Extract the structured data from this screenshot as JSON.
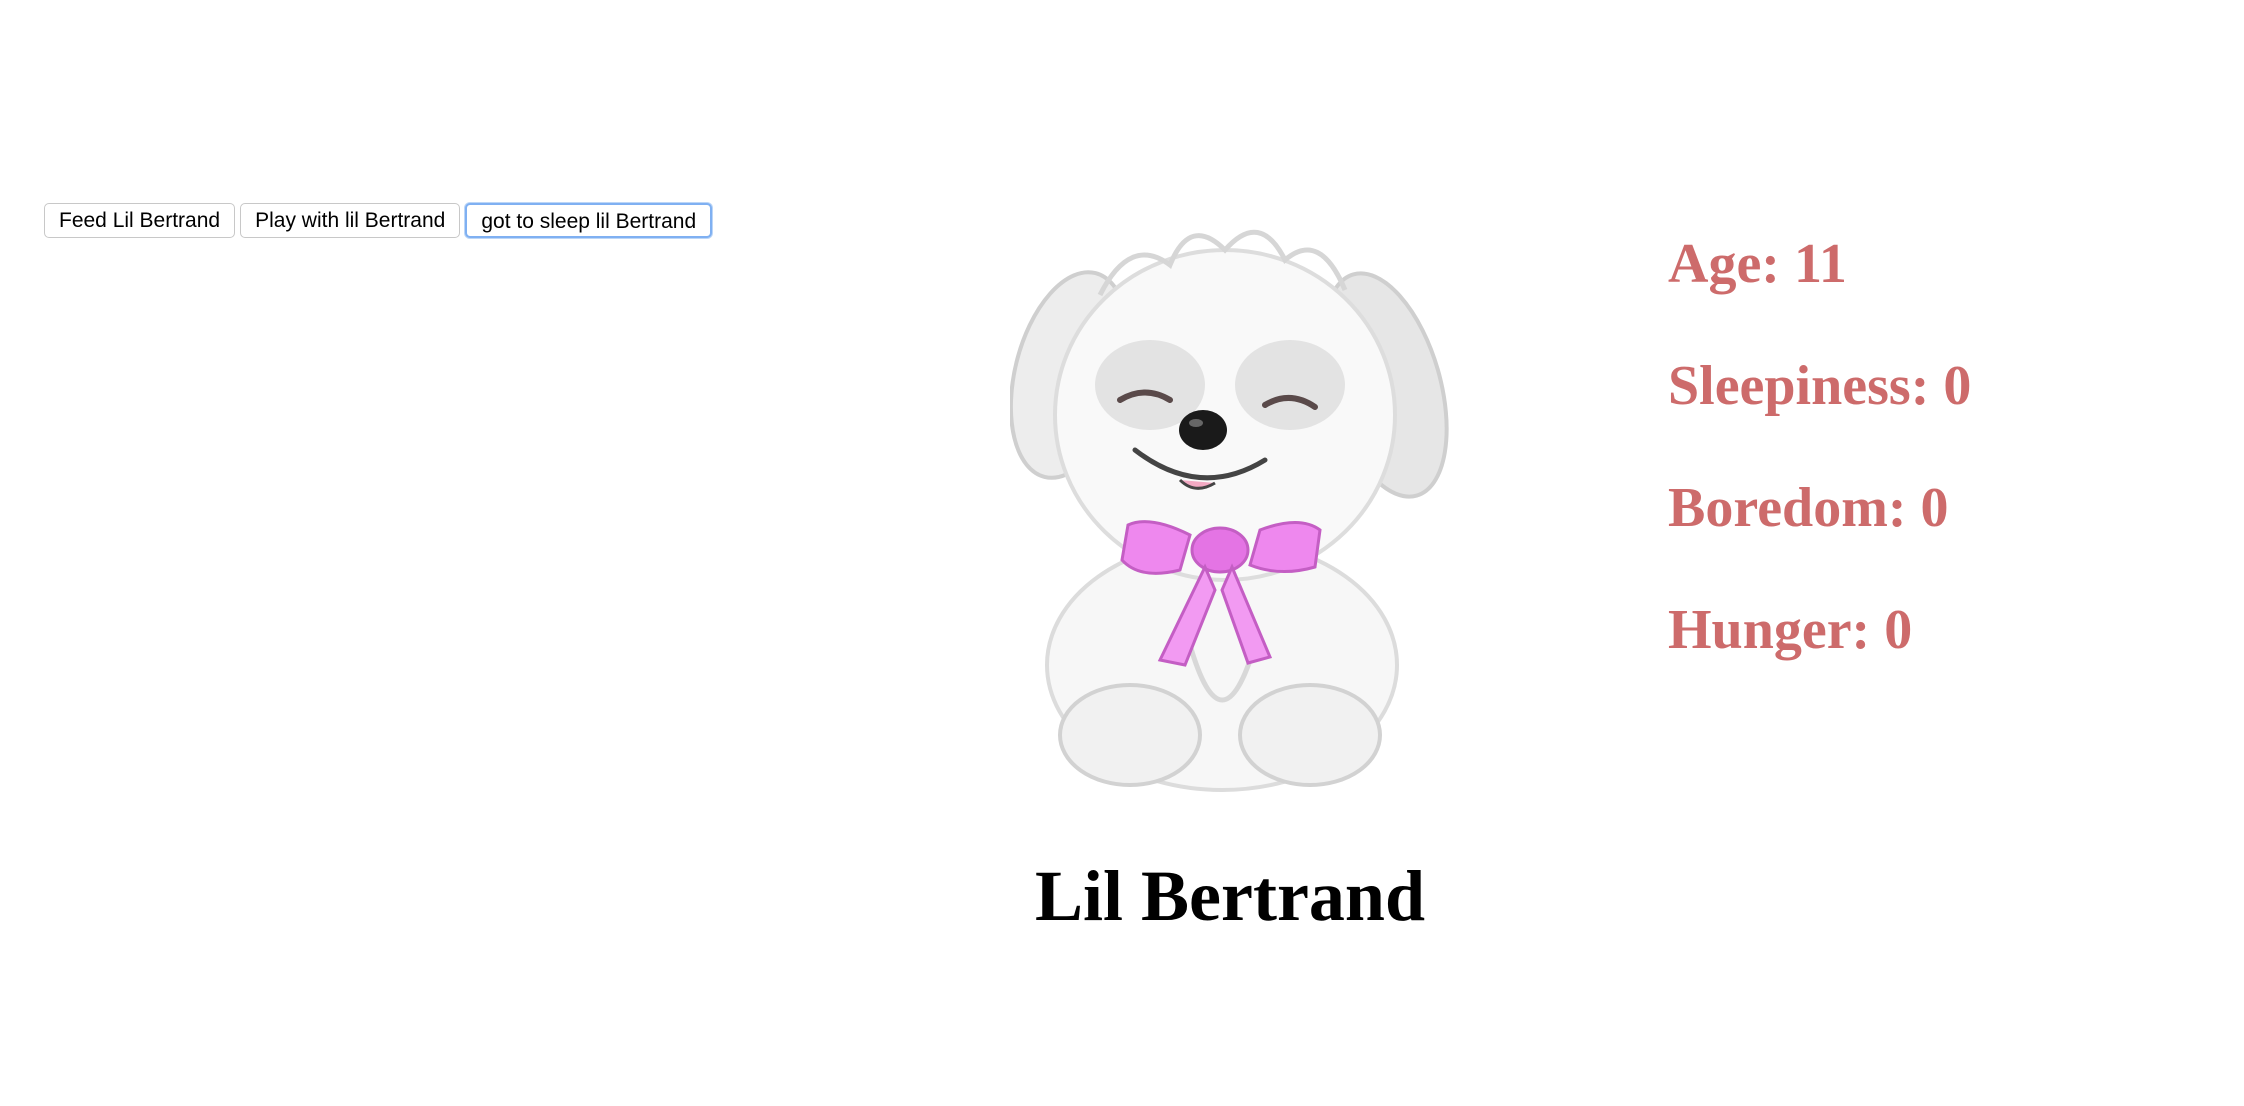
{
  "buttons": {
    "feed_label": "Feed Lil Bertrand",
    "play_label": "Play with lil Bertrand",
    "sleep_label": "got to sleep lil Bertrand"
  },
  "pet": {
    "name": "Lil Bertrand",
    "image_icon": "puppy-with-pink-bow"
  },
  "stats": {
    "age": "Age: 11",
    "sleepiness": "Sleepiness: 0",
    "boredom": "Boredom: 0",
    "hunger": "Hunger: 0"
  },
  "colors": {
    "stat_text": "#cd6b6b",
    "bow": "#ee88ee",
    "focus_ring": "#7fb0f2"
  }
}
